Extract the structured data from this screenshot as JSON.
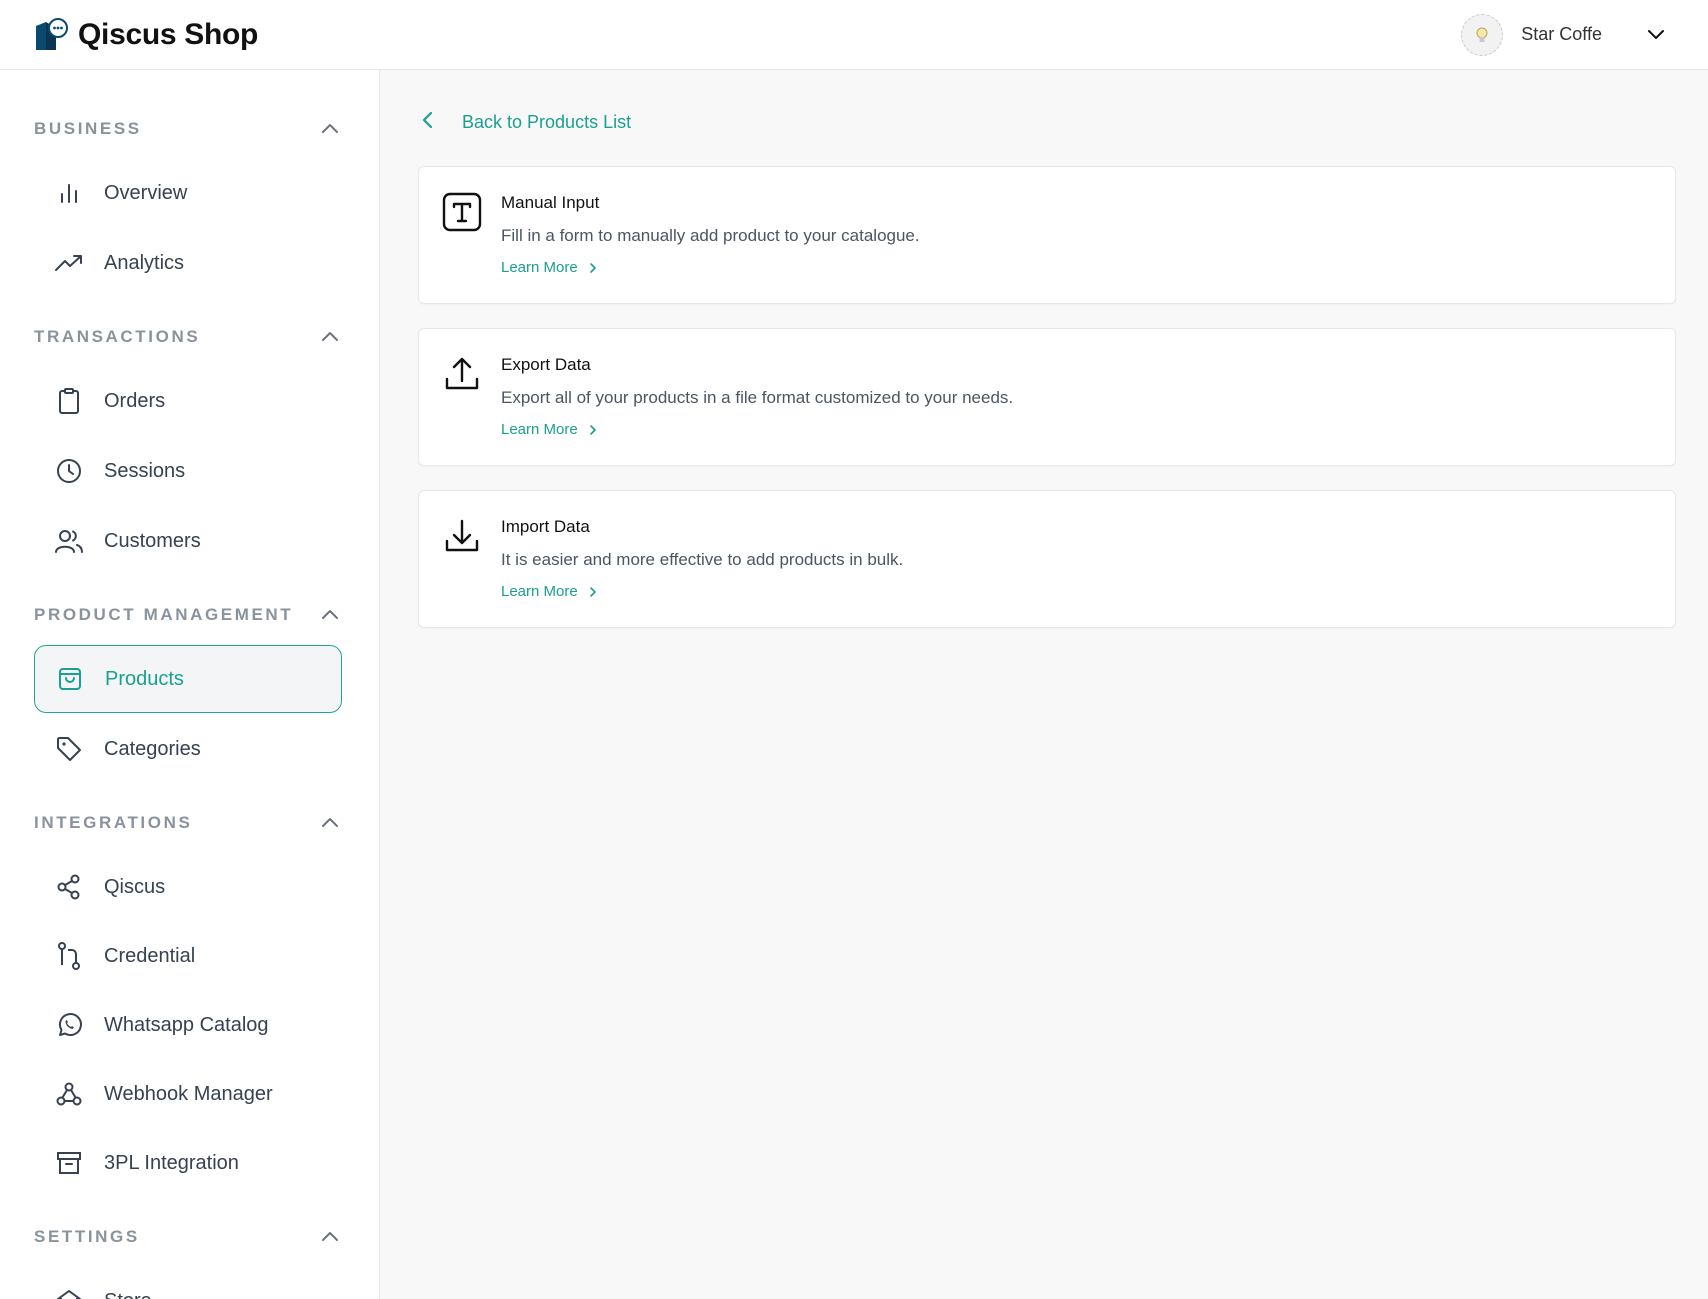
{
  "header": {
    "brand_name": "Qiscus Shop",
    "user_name": "Star Coffe",
    "accent_color": "#1aa08f"
  },
  "sidebar": {
    "sections": [
      {
        "title": "BUSINESS",
        "items": [
          {
            "label": "Overview",
            "icon": "bar-chart-icon"
          },
          {
            "label": "Analytics",
            "icon": "trending-up-icon"
          }
        ]
      },
      {
        "title": "TRANSACTIONS",
        "items": [
          {
            "label": "Orders",
            "icon": "clipboard-icon"
          },
          {
            "label": "Sessions",
            "icon": "clock-icon"
          },
          {
            "label": "Customers",
            "icon": "users-icon"
          }
        ]
      },
      {
        "title": "PRODUCT MANAGEMENT",
        "items": [
          {
            "label": "Products",
            "icon": "shopping-bag-icon",
            "active": true
          },
          {
            "label": "Categories",
            "icon": "tag-icon"
          }
        ]
      },
      {
        "title": "INTEGRATIONS",
        "items": [
          {
            "label": "Qiscus",
            "icon": "share-icon"
          },
          {
            "label": "Credential",
            "icon": "git-pull-icon"
          },
          {
            "label": "Whatsapp Catalog",
            "icon": "whatsapp-icon"
          },
          {
            "label": "Webhook Manager",
            "icon": "webhook-icon"
          },
          {
            "label": "3PL Integration",
            "icon": "archive-icon"
          }
        ]
      },
      {
        "title": "SETTINGS",
        "items": [
          {
            "label": "Store",
            "icon": "store-icon"
          }
        ]
      }
    ]
  },
  "main": {
    "back_label": "Back to Products List",
    "cards": [
      {
        "title": "Manual Input",
        "description": "Fill in a form to manually add product to your catalogue.",
        "link": "Learn More",
        "icon": "text-box-icon"
      },
      {
        "title": "Export Data",
        "description": "Export all of your products in a file format customized to your needs.",
        "link": "Learn More",
        "icon": "upload-icon"
      },
      {
        "title": "Import Data",
        "description": "It is easier and more effective to add products in bulk.",
        "link": "Learn More",
        "icon": "download-icon"
      }
    ]
  }
}
